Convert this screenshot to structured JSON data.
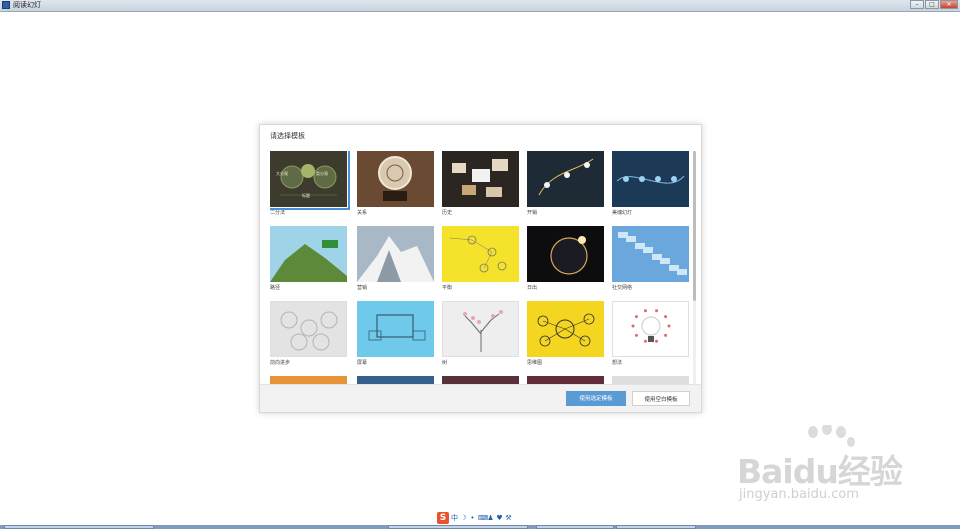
{
  "window": {
    "title": "阅读幻灯",
    "buttons": {
      "minimize": "–",
      "maximize": "□",
      "close": "✕"
    }
  },
  "dialog": {
    "title": "请选择模板",
    "selected_index": 0,
    "templates": [
      {
        "label": "二分法",
        "bg": "#3d3a2e",
        "mark_text": [
          "大分观",
          "类分观",
          "标题"
        ]
      },
      {
        "label": "关系",
        "bg": "#6b4a34"
      },
      {
        "label": "历史",
        "bg": "#2b2622"
      },
      {
        "label": "开销",
        "bg": "#1e2a35"
      },
      {
        "label": "美魂幻灯",
        "bg": "#1c3a56"
      },
      {
        "label": "路径",
        "bg": "#9fd4e8"
      },
      {
        "label": "营销",
        "bg": "#a8b8c6"
      },
      {
        "label": "平衡",
        "bg": "#f5e22a"
      },
      {
        "label": "日出",
        "bg": "#0d0d10"
      },
      {
        "label": "社交网络",
        "bg": "#6aa7dc"
      },
      {
        "label": "前向进步",
        "bg": "#e3e3e3"
      },
      {
        "label": "屏幕",
        "bg": "#6ec9ea"
      },
      {
        "label": "树",
        "bg": "#eeeeee"
      },
      {
        "label": "思维图",
        "bg": "#f4d51f"
      },
      {
        "label": "想法",
        "bg": "#ffffff"
      },
      {
        "label": "",
        "bg": "#e58a27"
      },
      {
        "label": "",
        "bg": "#245383"
      },
      {
        "label": "",
        "bg": "#4a1f2a"
      },
      {
        "label": "",
        "bg": "#541c2a"
      },
      {
        "label": "",
        "bg": "#dcdcdc"
      }
    ],
    "buttons": {
      "use_selected": "使用选定模板",
      "use_blank": "使用空白模板"
    }
  },
  "watermark": {
    "text": "Baidu经验",
    "url": "jingyan.baidu.com"
  },
  "ime": {
    "logo": "S",
    "mode": "中"
  },
  "colors": {
    "accent": "#5b9bd5",
    "selection": "#4a90d9"
  }
}
